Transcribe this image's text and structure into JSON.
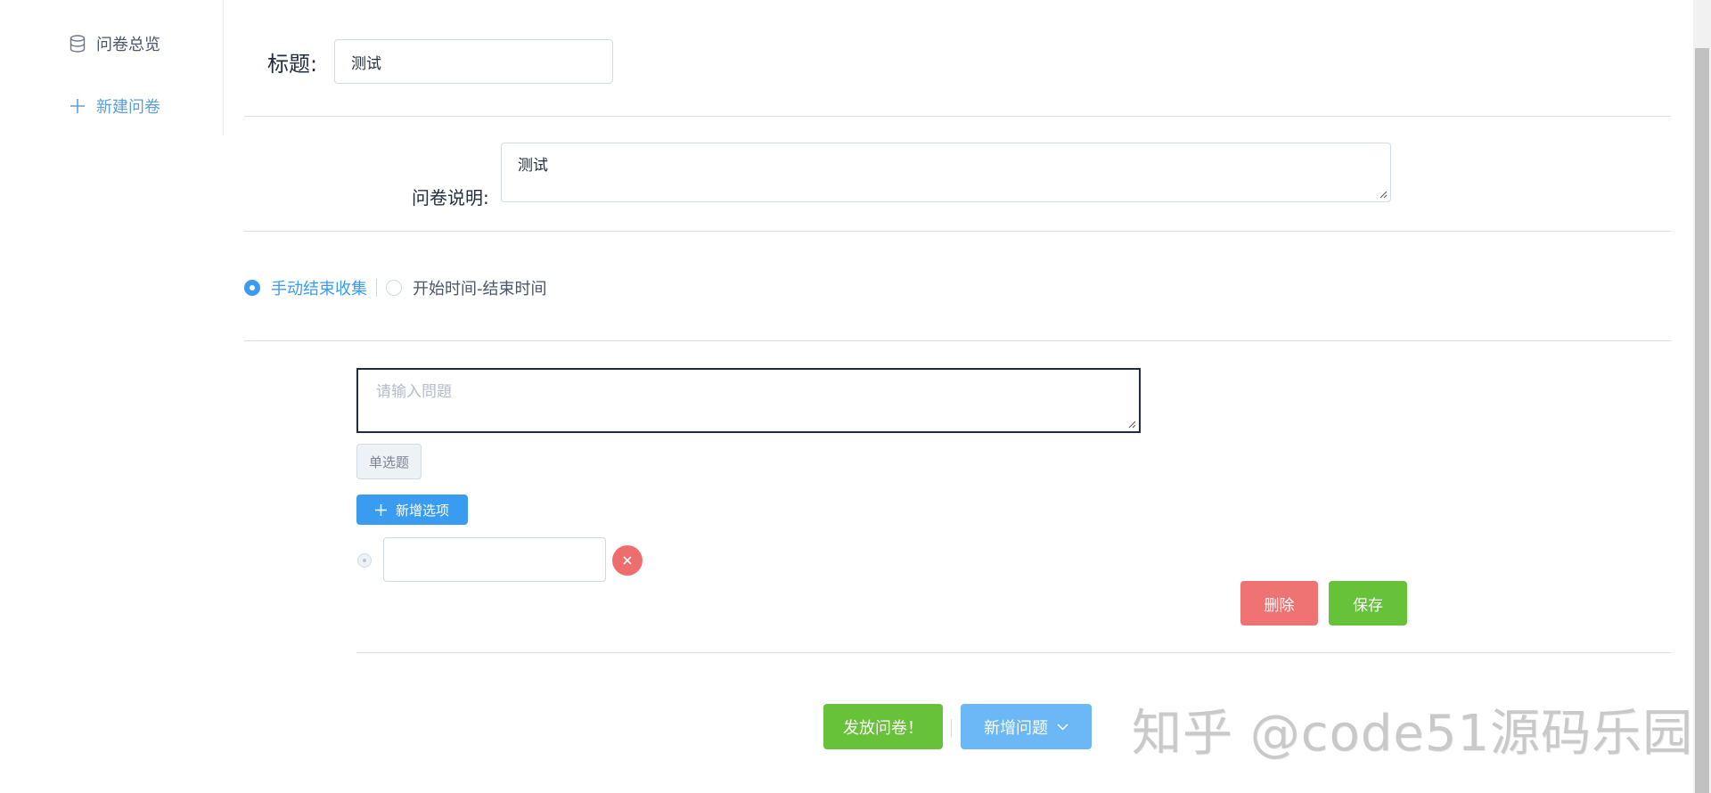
{
  "sidebar": {
    "items": [
      {
        "label": "问卷总览",
        "icon": "database-icon"
      },
      {
        "label": "新建问卷",
        "icon": "plus-icon"
      }
    ]
  },
  "form": {
    "title_label": "标题:",
    "title_value": "测试",
    "desc_label": "问卷说明:",
    "desc_value": "测试"
  },
  "collection": {
    "options": [
      {
        "label": "手动结束收集",
        "selected": true
      },
      {
        "label": "开始时间-结束时间",
        "selected": false
      }
    ]
  },
  "question": {
    "placeholder": "请输入問題",
    "type_label": "单选题",
    "add_option_label": "新增选项",
    "option_value": "",
    "delete_label": "删除",
    "save_label": "保存"
  },
  "actions": {
    "publish_label": "发放问卷！",
    "new_question_label": "新增问题"
  },
  "watermark": "知乎 @code51源码乐园",
  "colors": {
    "primary": "#3a9cf0",
    "success": "#67c23a",
    "danger": "#f07373",
    "link": "#5b9fd6"
  }
}
